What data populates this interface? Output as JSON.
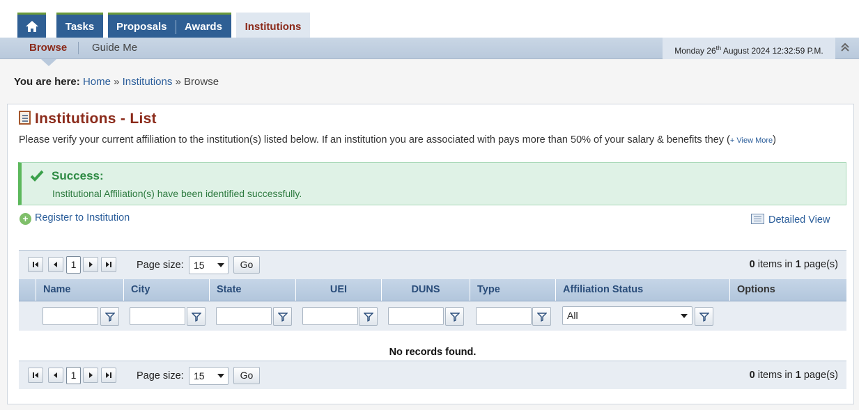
{
  "nav": {
    "tabs": [
      {
        "label": "Tasks"
      },
      {
        "label": "Proposals"
      },
      {
        "label": "Awards"
      },
      {
        "label": "Institutions"
      }
    ],
    "home_icon": "home-icon"
  },
  "subnav": {
    "browse": "Browse",
    "guide": "Guide Me",
    "date": "Monday 26",
    "date_sup": "th",
    "date_rest": " August 2024 12:32:59 P.M."
  },
  "breadcrumb": {
    "prefix": "You are here:",
    "items": [
      "Home",
      "Institutions",
      "Browse"
    ],
    "sep": "»"
  },
  "page": {
    "title": "Institutions - List",
    "description": "Please verify your current affiliation to the institution(s) listed below. If an institution you are associated with pays more than 50% of your salary & benefits they (",
    "view_more": "+ View More",
    "desc_close": ")"
  },
  "alert": {
    "heading": "Success:",
    "message": "Institutional Affiliation(s) have been identified successfully."
  },
  "actions": {
    "register": "Register to Institution",
    "detailed": "Detailed View"
  },
  "grid": {
    "page_number": "1",
    "page_size_label": "Page size:",
    "page_size": "15",
    "go": "Go",
    "items_count": "0",
    "items_text": " items in ",
    "pages_count": "1",
    "pages_text": " page(s)",
    "columns": [
      "Name",
      "City",
      "State",
      "UEI",
      "DUNS",
      "Type",
      "Affiliation Status",
      "Options"
    ],
    "affiliation_filter": "All",
    "empty_message": "No records found."
  },
  "colors": {
    "nav_blue": "#2f5f94",
    "active_tab_text": "#8b2a1a",
    "success_green": "#2d8a43",
    "link_blue": "#2a5d9a"
  }
}
